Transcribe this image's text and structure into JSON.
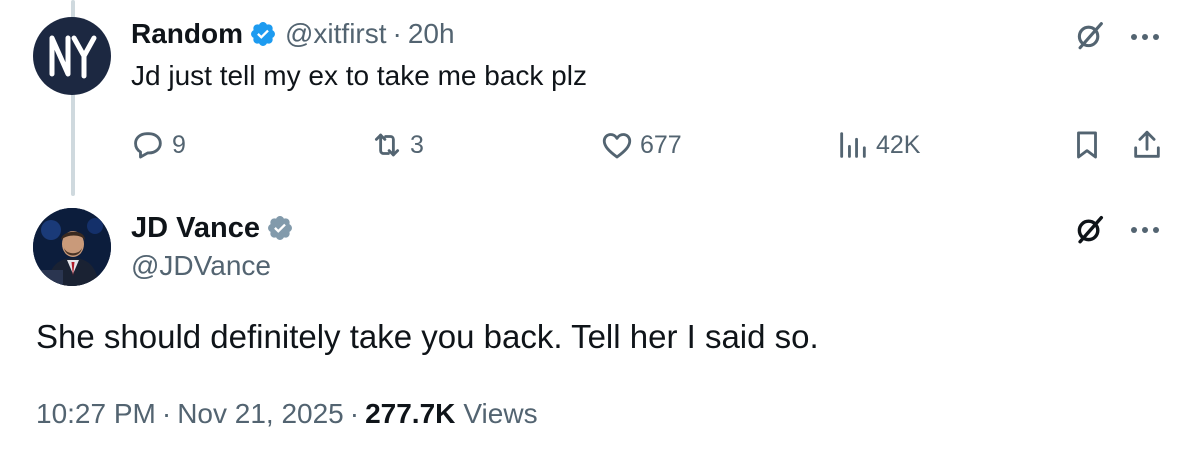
{
  "parent_tweet": {
    "author_name": "Random",
    "handle": "@xitfirst",
    "separator": "·",
    "time": "20h",
    "text": "Jd just tell my ex to take me back plz",
    "avatar_icon": "yankees-logo-icon",
    "actions": {
      "replies": "9",
      "reposts": "3",
      "likes": "677",
      "views": "42K"
    }
  },
  "main_tweet": {
    "author_name": "JD Vance",
    "handle": "@JDVance",
    "text": "She should definitely take you back. Tell her I said so.",
    "time": "10:27 PM",
    "date": "Nov 21, 2025",
    "separator": "·",
    "views_count": "277.7K",
    "views_label": "Views"
  },
  "colors": {
    "verified_blue": "#1d9bf0",
    "verified_gray": "#829aab",
    "secondary_text": "#536471",
    "primary_text": "#0f1419",
    "thread_line": "#cfd9de"
  }
}
